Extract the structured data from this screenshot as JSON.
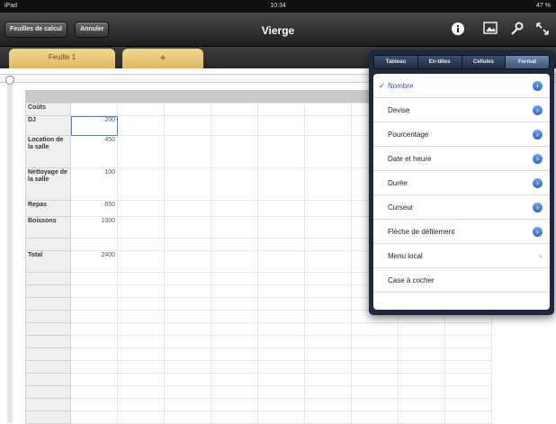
{
  "status_bar": {
    "device": "iPad",
    "time": "10:34",
    "battery": "47 %"
  },
  "toolbar": {
    "spreadsheets_label": "Feuilles de calcul",
    "undo_label": "Annuler",
    "title": "Vierge",
    "icons": [
      "info-icon",
      "image-icon",
      "wrench-icon",
      "fullscreen-icon"
    ]
  },
  "sheet_tabs": [
    {
      "label": "Feuille 1"
    },
    {
      "label": "+"
    }
  ],
  "table": {
    "rows": [
      {
        "label": "Coûts",
        "value": ""
      },
      {
        "label": "DJ",
        "value": "200"
      },
      {
        "label": "Location de la salle",
        "value": "450"
      },
      {
        "label": "Nettoyage de la salle",
        "value": "100"
      },
      {
        "label": "Repas",
        "value": "650"
      },
      {
        "label": "Boissons",
        "value": "1000"
      },
      {
        "label": "",
        "value": ""
      },
      {
        "label": "Total",
        "value": "2400"
      }
    ]
  },
  "popover": {
    "segments": [
      "Tableau",
      "En-têtes",
      "Cellules",
      "Format"
    ],
    "active_segment": "Format",
    "items": [
      {
        "label": "Nombre",
        "checked": true,
        "accessory": "disclosure"
      },
      {
        "label": "Devise",
        "checked": false,
        "accessory": "disclosure"
      },
      {
        "label": "Pourcentage",
        "checked": false,
        "accessory": "disclosure"
      },
      {
        "label": "Date et heure",
        "checked": false,
        "accessory": "disclosure"
      },
      {
        "label": "Durée",
        "checked": false,
        "accessory": "disclosure"
      },
      {
        "label": "Curseur",
        "checked": false,
        "accessory": "disclosure"
      },
      {
        "label": "Flèche de défilement",
        "checked": false,
        "accessory": "disclosure"
      },
      {
        "label": "Menu local",
        "checked": false,
        "accessory": "chevron"
      },
      {
        "label": "Case à cocher",
        "checked": false,
        "accessory": "none"
      }
    ],
    "check_glyph": "✓",
    "disclosure_glyph": "›",
    "chevron_glyph": "›"
  },
  "colors": {
    "accent": "#3656b5",
    "popover_bg": "#1d2a3e",
    "tab": "#e8c26c"
  }
}
